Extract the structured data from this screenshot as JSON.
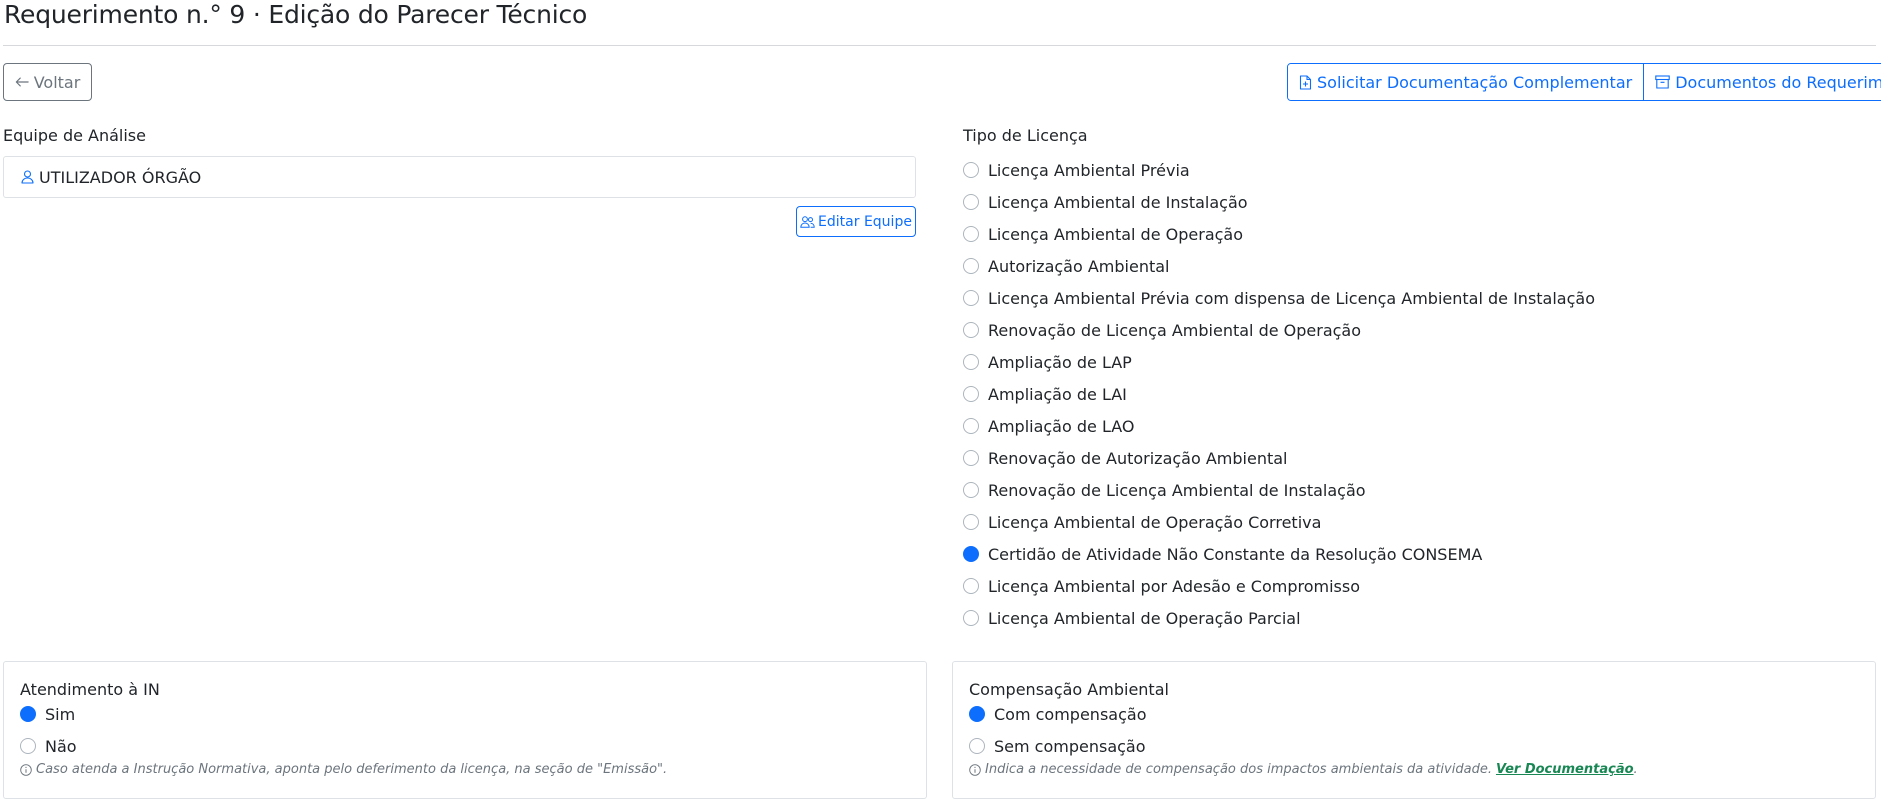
{
  "page": {
    "title": "Requerimento n.° 9 · Edição do Parecer Técnico"
  },
  "toolbar": {
    "back_label": "Voltar",
    "request_docs_label": "Solicitar Documentação Complementar",
    "request_docs_icon": "file-plus-icon",
    "docs_label": "Documentos do Requerimento",
    "docs_icon": "archive-icon"
  },
  "team": {
    "label": "Equipe de Análise",
    "member": "UTILIZADOR ÓRGÃO",
    "member_icon": "user-icon",
    "edit_label": "Editar Equipe",
    "edit_icon": "users-icon"
  },
  "license": {
    "label": "Tipo de Licença",
    "selected_index": 12,
    "options": [
      "Licença Ambiental Prévia",
      "Licença Ambiental de Instalação",
      "Licença Ambiental de Operação",
      "Autorização Ambiental",
      "Licença Ambiental Prévia com dispensa de Licença Ambiental de Instalação",
      "Renovação de Licença Ambiental de Operação",
      "Ampliação de LAP",
      "Ampliação de LAI",
      "Ampliação de LAO",
      "Renovação de Autorização Ambiental",
      "Renovação de Licença Ambiental de Instalação",
      "Licença Ambiental de Operação Corretiva",
      "Certidão de Atividade Não Constante da Resolução CONSEMA",
      "Licença Ambiental por Adesão e Compromisso",
      "Licença Ambiental de Operação Parcial"
    ]
  },
  "in_compliance": {
    "title": "Atendimento à IN",
    "yes_label": "Sim",
    "no_label": "Não",
    "selected": "yes",
    "hint": "Caso atenda a Instrução Normativa, aponta pelo deferimento da licença, na seção de \"Emissão\".",
    "hint_icon": "info-circle-icon"
  },
  "compensation": {
    "title": "Compensação Ambiental",
    "with_label": "Com compensação",
    "without_label": "Sem compensação",
    "selected": "with",
    "hint": "Indica a necessidade de compensação dos impactos ambientais da atividade.",
    "hint_link": "Ver Documentação",
    "hint_suffix": ".",
    "hint_icon": "info-circle-icon"
  },
  "colors": {
    "primary": "#0d6efd",
    "secondary": "#6c757d",
    "link": "#198754",
    "border": "#dee2e6"
  }
}
